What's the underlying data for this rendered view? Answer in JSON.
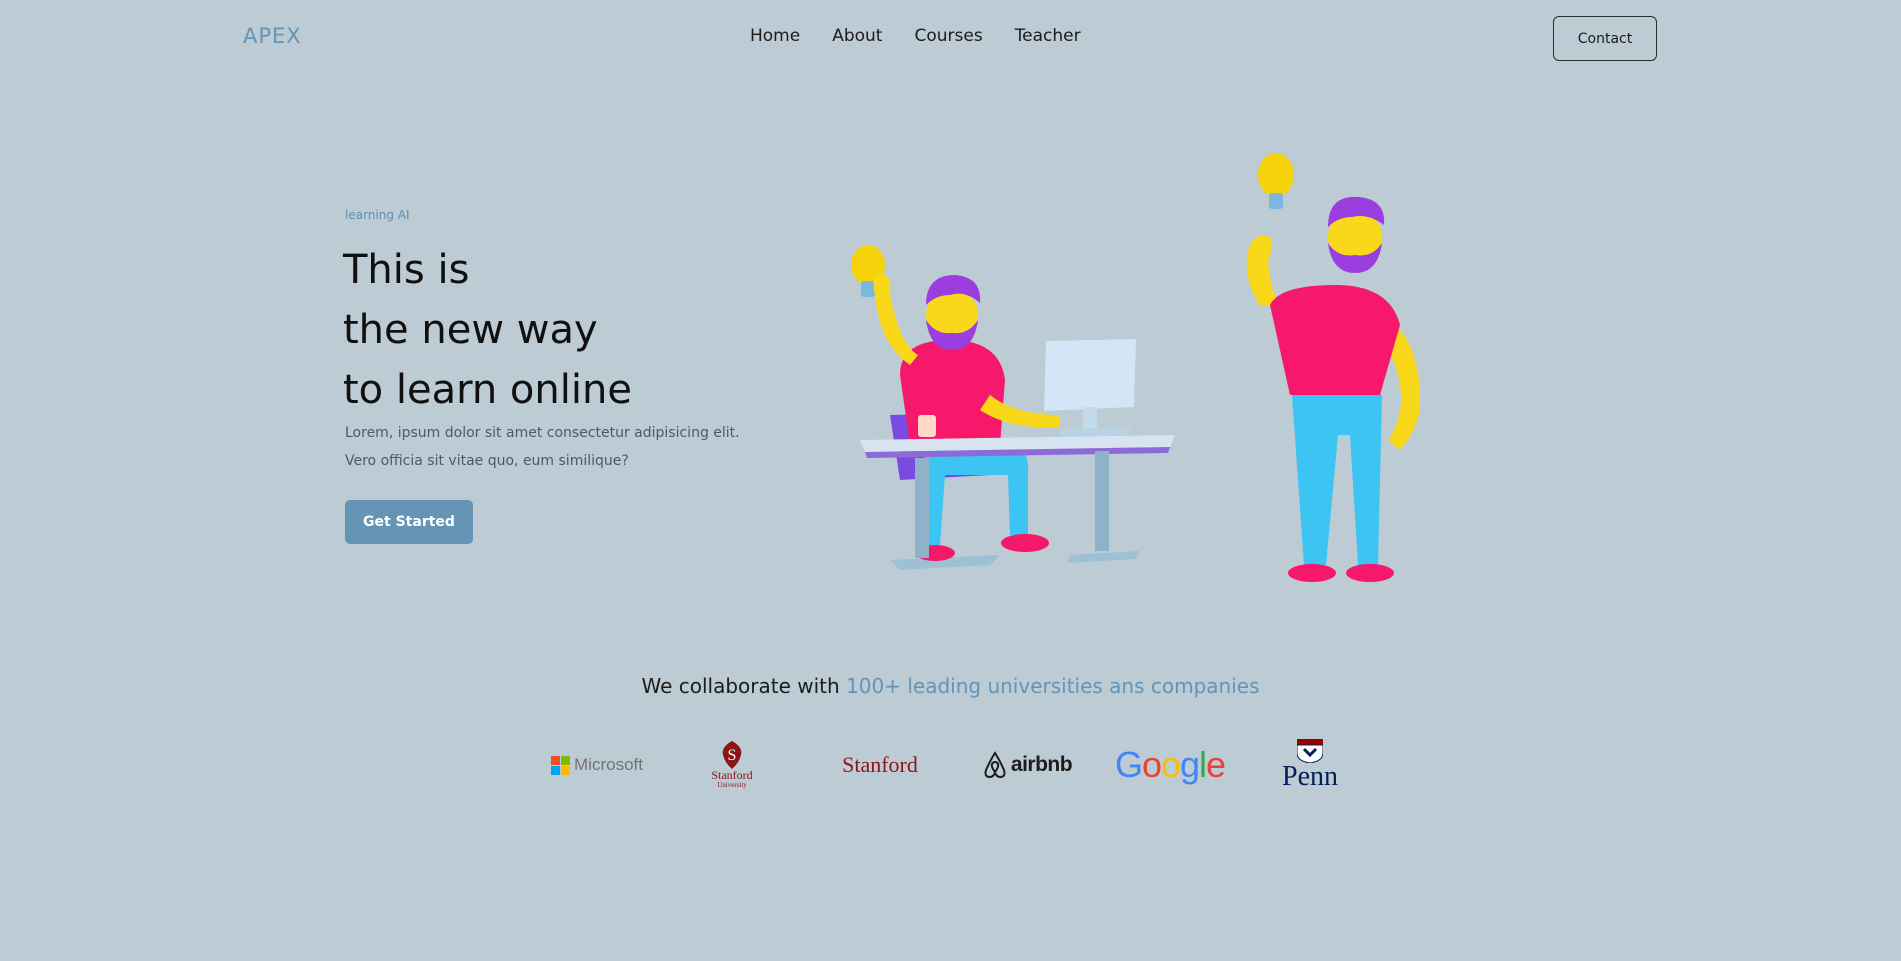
{
  "header": {
    "logo": "APEX",
    "nav": [
      "Home",
      "About",
      "Courses",
      "Teacher"
    ],
    "contact_label": "Contact"
  },
  "hero": {
    "eyebrow": "learning AI",
    "title_lines": [
      "This is",
      "the new way",
      "to learn online"
    ],
    "description": "Lorem, ipsum dolor sit amet consectetur adipisicing elit. Vero officia sit vitae quo, eum similique?",
    "cta_label": "Get Started",
    "illustration_icon": "3d-people-learning-illustration"
  },
  "collab": {
    "prefix": "We collaborate with ",
    "highlight": "100+ leading universities ans companies"
  },
  "partners": {
    "microsoft": "Microsoft",
    "stanford_seal_main": "Stanford",
    "stanford_seal_sub": "University",
    "stanford_wordmark": "Stanford",
    "airbnb": "airbnb",
    "google": [
      "G",
      "o",
      "o",
      "g",
      "l",
      "e"
    ],
    "penn": "Penn"
  },
  "colors": {
    "background": "#bccbd4",
    "accent": "#6594b4",
    "google": [
      "#4285F4",
      "#EA4335",
      "#FBBC05",
      "#4285F4",
      "#34A853",
      "#EA4335"
    ]
  }
}
